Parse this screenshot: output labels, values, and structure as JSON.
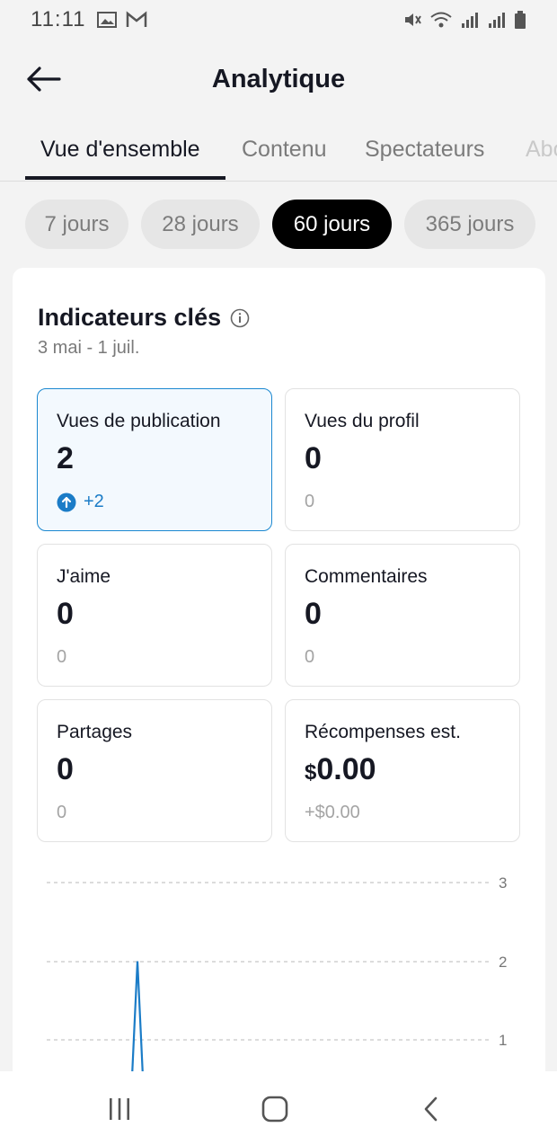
{
  "status_bar": {
    "time": "11:11"
  },
  "header": {
    "title": "Analytique"
  },
  "tabs": [
    {
      "label": "Vue d'ensemble",
      "active": true
    },
    {
      "label": "Contenu",
      "active": false
    },
    {
      "label": "Spectateurs",
      "active": false
    },
    {
      "label": "Abonnés",
      "active": false
    }
  ],
  "ranges": [
    {
      "label": "7 jours",
      "selected": false
    },
    {
      "label": "28 jours",
      "selected": false
    },
    {
      "label": "60 jours",
      "selected": true
    },
    {
      "label": "365 jours",
      "selected": false
    }
  ],
  "key_metrics": {
    "title": "Indicateurs clés",
    "date_range": "3 mai - 1 juil.",
    "items": [
      {
        "label": "Vues de publication",
        "value": "2",
        "change": "+2",
        "selected": true
      },
      {
        "label": "Vues du profil",
        "value": "0",
        "change": "0",
        "selected": false
      },
      {
        "label": "J'aime",
        "value": "0",
        "change": "0",
        "selected": false
      },
      {
        "label": "Commentaires",
        "value": "0",
        "change": "0",
        "selected": false
      },
      {
        "label": "Partages",
        "value": "0",
        "change": "0",
        "selected": false
      },
      {
        "label": "Récompenses est.",
        "currency": "$",
        "value": "0.00",
        "change": "+$0.00",
        "selected": false
      }
    ]
  },
  "chart_data": {
    "type": "line",
    "title": "",
    "xlabel": "",
    "ylabel": "",
    "y_ticks": [
      "1",
      "2",
      "3"
    ],
    "ylim": [
      0,
      3
    ],
    "grid": true,
    "series": [
      {
        "color": "#1b7cc7",
        "peak_value": 2
      }
    ]
  },
  "colors": {
    "accent": "#1b7cc7",
    "selected_chip": "#000000",
    "selected_card_border": "#1b88d0"
  }
}
